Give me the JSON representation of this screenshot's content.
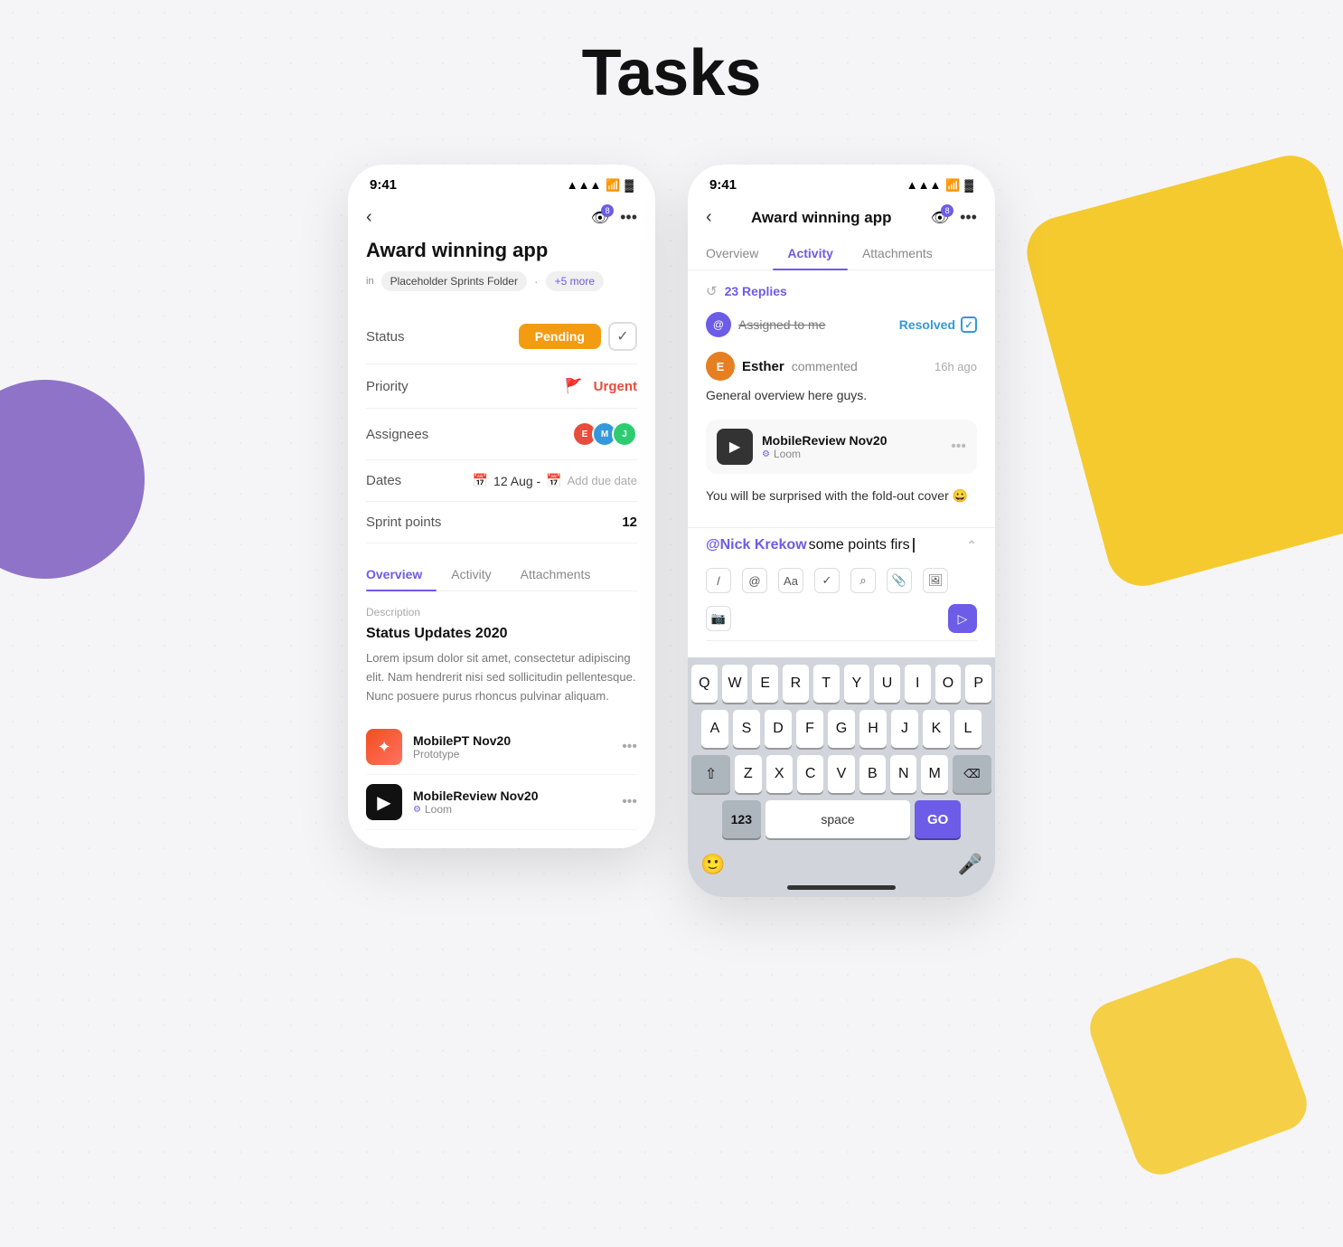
{
  "page": {
    "title": "Tasks"
  },
  "phone1": {
    "status_bar": {
      "time": "9:41",
      "signal": "▲▲▲",
      "wifi": "WiFi",
      "battery": "🔋"
    },
    "nav": {
      "back": "‹",
      "title": "",
      "eye_badge": "8",
      "more": "..."
    },
    "task_title": "Award winning app",
    "breadcrumb": {
      "in_label": "in",
      "folder": "Placeholder Sprints Folder",
      "dot": "·",
      "more": "+5 more"
    },
    "fields": [
      {
        "label": "Status",
        "value": "Pending",
        "type": "status"
      },
      {
        "label": "Priority",
        "value": "Urgent",
        "type": "priority"
      },
      {
        "label": "Assignees",
        "value": "",
        "type": "assignees"
      },
      {
        "label": "Dates",
        "value": "12 Aug -",
        "add_date": "Add due date",
        "type": "date"
      },
      {
        "label": "Sprint points",
        "value": "12",
        "type": "number"
      }
    ],
    "tabs": [
      {
        "label": "Overview",
        "active": true
      },
      {
        "label": "Activity",
        "active": false
      },
      {
        "label": "Attachments",
        "active": false
      }
    ],
    "description": {
      "section_label": "Description",
      "title": "Status Updates 2020",
      "text": "Lorem ipsum dolor sit amet, consectetur adipiscing elit. Nam hendrerit nisi sed sollicitudin pellentesque. Nunc posuere purus rhoncus pulvinar aliquam."
    },
    "attachments": [
      {
        "name": "MobilePT Nov20",
        "sub": "Prototype",
        "type": "figma"
      },
      {
        "name": "MobileReview Nov20",
        "sub": "Loom",
        "type": "loom"
      }
    ]
  },
  "phone2": {
    "status_bar": {
      "time": "9:41"
    },
    "nav": {
      "back": "‹",
      "title": "Award winning app",
      "eye_badge": "8",
      "more": "..."
    },
    "tabs": [
      {
        "label": "Overview",
        "active": false
      },
      {
        "label": "Activity",
        "active": true
      },
      {
        "label": "Attachments",
        "active": false
      }
    ],
    "replies": "23 Replies",
    "assigned_to_me": "Assigned to me",
    "resolved": "Resolved",
    "comment": {
      "user": "Esther",
      "action": "commented",
      "time": "16h ago",
      "text": "General overview here guys."
    },
    "video_card": {
      "title": "MobileReview Nov20",
      "sub": "Loom"
    },
    "comment2_text": "You will be surprised with the fold-out cover 😀",
    "reply_input": {
      "mention": "@Nick Krekow",
      "text": " some points firs"
    },
    "toolbar_buttons": [
      "/",
      "@",
      "Aa",
      "✓",
      "🔍",
      "📎",
      "🖼",
      "📷"
    ],
    "keyboard": {
      "row1": [
        "Q",
        "W",
        "E",
        "R",
        "T",
        "Y",
        "U",
        "I",
        "O",
        "P"
      ],
      "row2": [
        "A",
        "S",
        "D",
        "F",
        "G",
        "H",
        "J",
        "K",
        "L"
      ],
      "row3": [
        "Z",
        "X",
        "C",
        "V",
        "B",
        "N",
        "M"
      ],
      "space_label": "space",
      "go_label": "GO",
      "nums_label": "123"
    }
  }
}
